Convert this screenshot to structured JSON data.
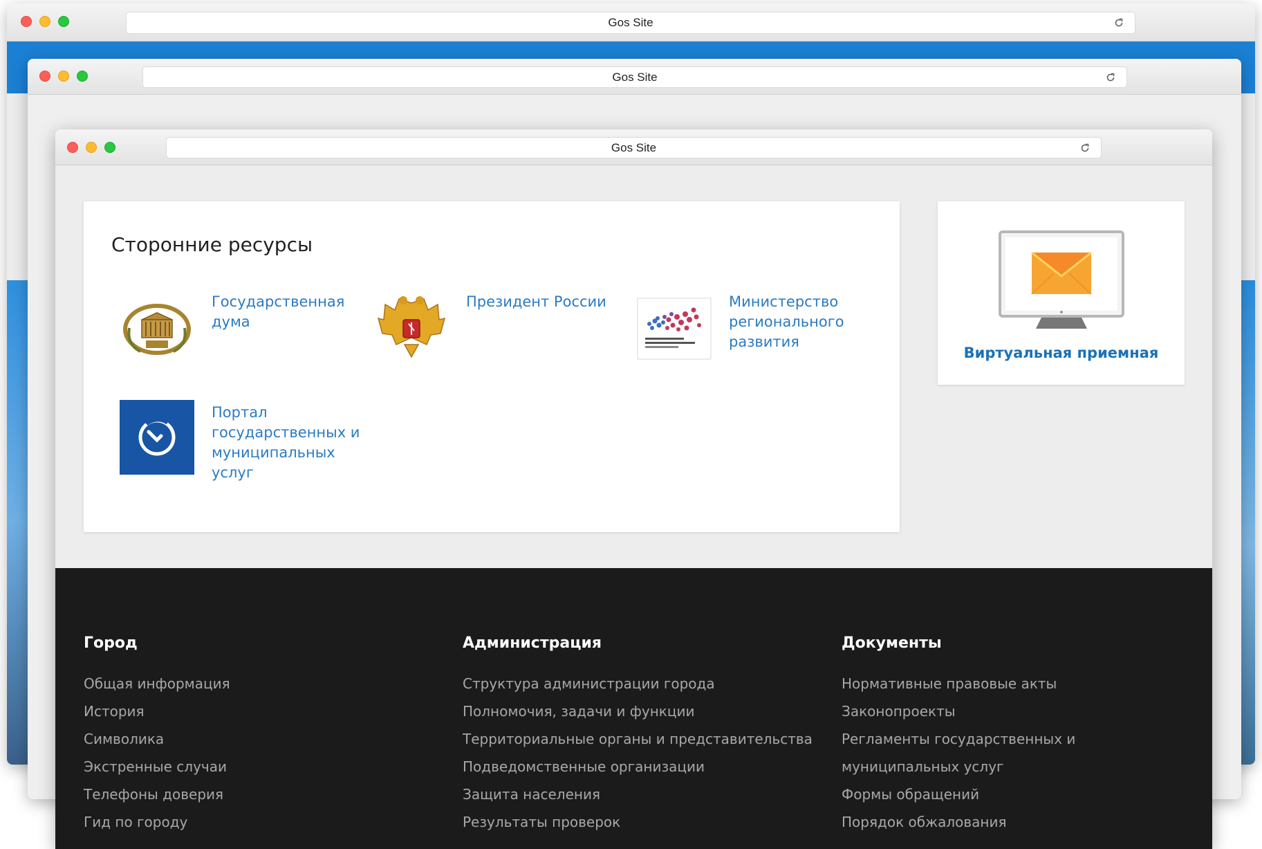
{
  "windows": [
    {
      "title": "Gos Site"
    },
    {
      "title": "Gos Site"
    },
    {
      "title": "Gos Site"
    }
  ],
  "resources": {
    "title": "Сторонние ресурсы",
    "items": [
      {
        "label": "Государственная дума",
        "icon": "duma-emblem-icon"
      },
      {
        "label": "Президент России",
        "icon": "russia-coat-of-arms-icon"
      },
      {
        "label": "Министерство регионального развития",
        "icon": "ministry-logo-icon"
      },
      {
        "label": "Портал государственных и муниципальных услуг",
        "icon": "gosuslugi-icon"
      }
    ]
  },
  "virtual_reception": {
    "label": "Виртуальная приемная",
    "icon": "monitor-mail-icon"
  },
  "footer": {
    "columns": [
      {
        "heading": "Город",
        "links": [
          "Общая информация",
          "История",
          "Символика",
          "Экстренные случаи",
          "Телефоны доверия",
          "Гид по городу"
        ]
      },
      {
        "heading": "Администрация",
        "links": [
          "Структура администрации города",
          "Полномочия, задачи и функции",
          "Территориальные органы и представительства",
          "Подведомственные организации",
          "Защита населения",
          "Результаты проверок"
        ]
      },
      {
        "heading": "Документы",
        "links": [
          "Нормативные правовые акты",
          "Законопроекты",
          "Регламенты государственных и",
          "муниципальных услуг",
          "Формы обращений",
          "Порядок обжалования"
        ]
      }
    ]
  },
  "colors": {
    "link": "#2a7bc4",
    "footer_bg": "#1b1b1b",
    "accent_blue": "#1b7fd3"
  }
}
